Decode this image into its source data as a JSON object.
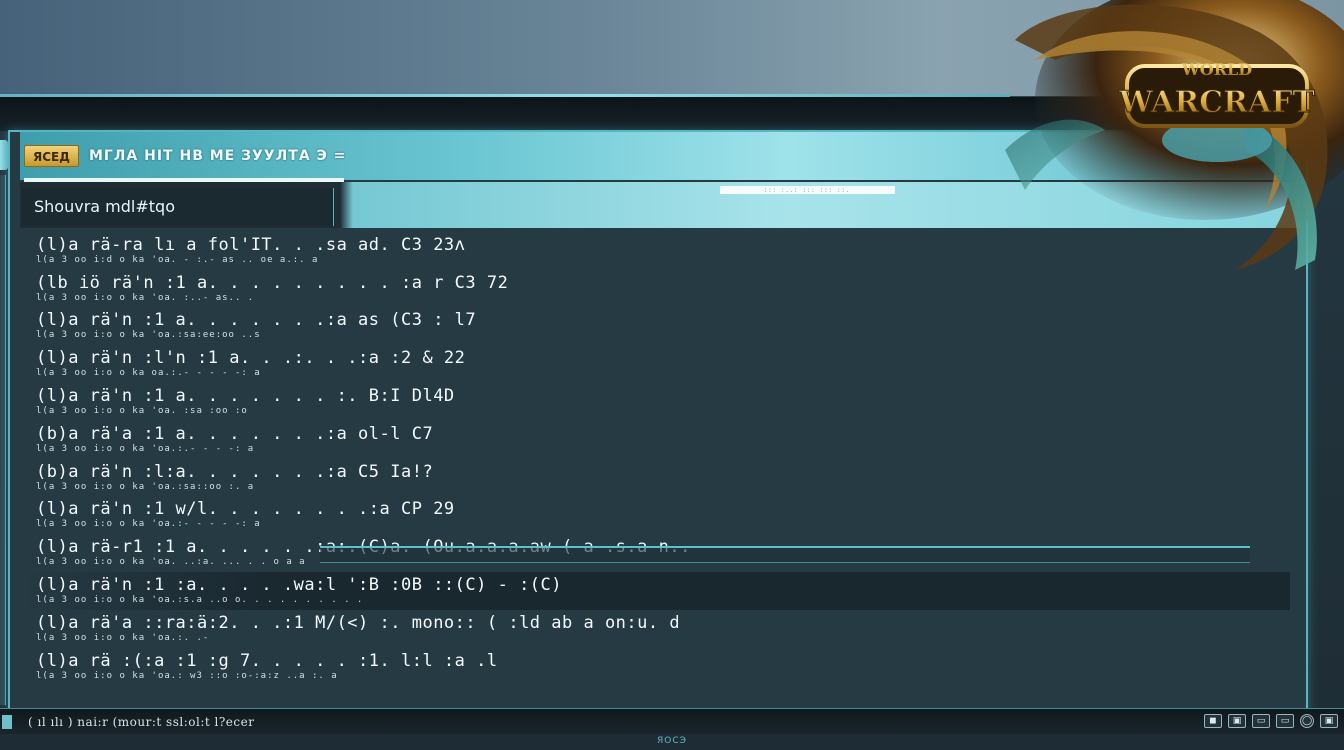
{
  "window": {
    "title_badge": "ЯСЕД",
    "title": "МГЛА НІТ НВ МЕ ЗУУЛТА Э =",
    "active_tab": "Ѕhouvra mdl#tqo",
    "tab_strip_text": "::: :..: ::: ::: ::."
  },
  "log": [
    {
      "main": "(l)a rä-ra lı a fol'IT. . .sa ad. C3 23ʌ",
      "sub": "l(a 3 oo i:d o ka 'oa. - :.- as .. oe a.:. a"
    },
    {
      "main": "(lb iö rä'n :1 a. . . . . . . . . :a r C3 72",
      "sub": "l(a 3 oo i:o o ka 'oa. :..- as.. ."
    },
    {
      "main": "(l)a rä'n :1 a. . . . . . .:a as (C3 : l7",
      "sub": "l(a 3 oo i:o o ka 'oa.:sa:ee:oo ..s"
    },
    {
      "main": "(l)a rä'n :l'n :1 a. . .:. . .:a :2 & 22",
      "sub": "l(a 3 oo i:o o ka oa.:.- - - - -: a"
    },
    {
      "main": "(l)a rä'n :1 a. . . . . . . :. B:I Dl4D",
      "sub": "l(a 3 oo i:o o ka 'oa. :sa :oo :o"
    },
    {
      "main": "(b)a rä'a :1 a. . . . . . .:a ol-l C7",
      "sub": "l(a 3 oo i:o o ka 'oa.:.- - - -: a"
    },
    {
      "main": "(b)a rä'n :l:a. . . . . . .:a C5 Ia!?",
      "sub": "l(a 3 oo i:o o ka 'oa.:sa::oo :. a"
    },
    {
      "main": "(l)a rä'n :1 w/l. . . . . . . .:a CP 29",
      "sub": "l(a 3 oo i:o o ka 'oa.:- - - - -: a"
    },
    {
      "main": "(l)a rä-r1 :1 a. . . . . .:a:.(C)a. (Ou.a.a.a.aw ( a-.s.a-n..",
      "sub": "l(a 3 oo i:o o ka 'oa. ..:a. ... . . o a a"
    },
    {
      "main": "(l)a rä'n :1 :a. . . . .wa:l ':B :0B ::(C) - :(C)",
      "sub": "l(a 3 oo i:o o ka 'oa.:s.a ..o o. . . . . . . . . ."
    },
    {
      "main": "(l)a rä'a ::ra:ä:2. . .:1 M/(<) :. mono:: ( :ld ab a on:u. d",
      "sub": "l(a 3 oo i:o o ka 'oa.:. .-"
    },
    {
      "main": "(l)a rä :(:a :1 :g 7. . . . . :1. l:l :a .l",
      "sub": "l(a 3 oo i:o o ka 'oa.: w3 ::o :o-:a:z ..a :. a"
    }
  ],
  "statusbar": {
    "text": "( ıl ılı ) nai:r (mour:t ssl:ol:t l?ecer",
    "icons": [
      "◼",
      "▣",
      "▭",
      "▭",
      "◯",
      "▣"
    ]
  },
  "footer_label": "ЯОСЭ",
  "logo": {
    "text": "WARCRAFT",
    "subtext": "WORLD"
  },
  "colors": {
    "accent": "#56b6c4",
    "gold": "#d9a836",
    "panel": "#263a44"
  }
}
